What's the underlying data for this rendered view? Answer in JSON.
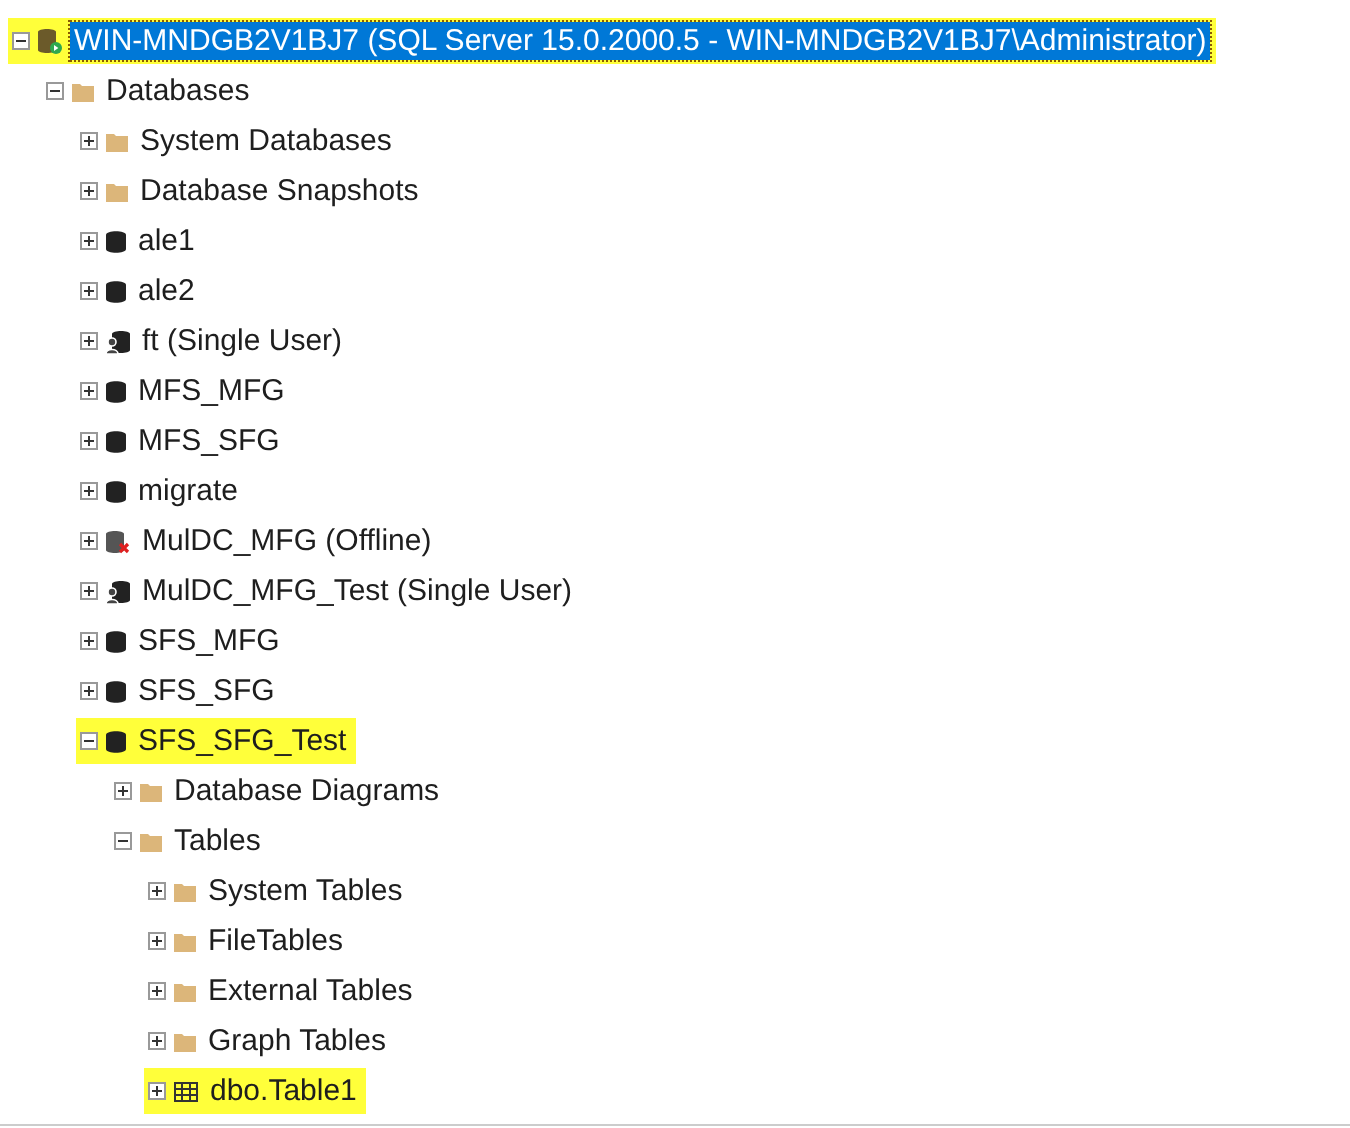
{
  "tree": [
    {
      "label": "WIN-MNDGB2V1BJ7 (SQL Server 15.0.2000.5 - WIN-MNDGB2V1BJ7\\Administrator)",
      "kind": "server",
      "expanded": true,
      "selected": true,
      "highlighted": true,
      "children": [
        {
          "label": "Databases",
          "kind": "folder",
          "expanded": true,
          "selected": false,
          "highlighted": false,
          "children": [
            {
              "label": "System Databases",
              "kind": "folder",
              "expanded": false,
              "selected": false,
              "highlighted": false
            },
            {
              "label": "Database Snapshots",
              "kind": "folder",
              "expanded": false,
              "selected": false,
              "highlighted": false
            },
            {
              "label": "ale1",
              "kind": "database",
              "expanded": false,
              "selected": false,
              "highlighted": false
            },
            {
              "label": "ale2",
              "kind": "database",
              "expanded": false,
              "selected": false,
              "highlighted": false
            },
            {
              "label": "ft (Single User)",
              "kind": "single-user",
              "expanded": false,
              "selected": false,
              "highlighted": false
            },
            {
              "label": "MFS_MFG",
              "kind": "database",
              "expanded": false,
              "selected": false,
              "highlighted": false
            },
            {
              "label": "MFS_SFG",
              "kind": "database",
              "expanded": false,
              "selected": false,
              "highlighted": false
            },
            {
              "label": "migrate",
              "kind": "database",
              "expanded": false,
              "selected": false,
              "highlighted": false
            },
            {
              "label": "MulDC_MFG (Offline)",
              "kind": "offline",
              "expanded": false,
              "selected": false,
              "highlighted": false
            },
            {
              "label": "MulDC_MFG_Test (Single User)",
              "kind": "single-user",
              "expanded": false,
              "selected": false,
              "highlighted": false
            },
            {
              "label": "SFS_MFG",
              "kind": "database",
              "expanded": false,
              "selected": false,
              "highlighted": false
            },
            {
              "label": "SFS_SFG",
              "kind": "database",
              "expanded": false,
              "selected": false,
              "highlighted": false
            },
            {
              "label": "SFS_SFG_Test",
              "kind": "database",
              "expanded": true,
              "selected": false,
              "highlighted": true,
              "children": [
                {
                  "label": "Database Diagrams",
                  "kind": "folder",
                  "expanded": false,
                  "selected": false,
                  "highlighted": false
                },
                {
                  "label": "Tables",
                  "kind": "folder",
                  "expanded": true,
                  "selected": false,
                  "highlighted": false,
                  "children": [
                    {
                      "label": "System Tables",
                      "kind": "folder",
                      "expanded": false,
                      "selected": false,
                      "highlighted": false
                    },
                    {
                      "label": "FileTables",
                      "kind": "folder",
                      "expanded": false,
                      "selected": false,
                      "highlighted": false
                    },
                    {
                      "label": "External Tables",
                      "kind": "folder",
                      "expanded": false,
                      "selected": false,
                      "highlighted": false
                    },
                    {
                      "label": "Graph Tables",
                      "kind": "folder",
                      "expanded": false,
                      "selected": false,
                      "highlighted": false
                    },
                    {
                      "label": "dbo.Table1",
                      "kind": "table",
                      "expanded": false,
                      "selected": false,
                      "highlighted": true
                    }
                  ]
                }
              ]
            }
          ]
        }
      ]
    }
  ]
}
